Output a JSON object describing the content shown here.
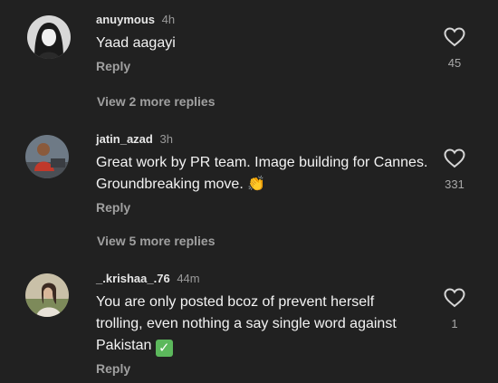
{
  "comments": [
    {
      "username": "anuymous",
      "time": "4h",
      "text": "Yaad aagayi",
      "reply_label": "Reply",
      "likes": "45",
      "avatar_icon": "profile-photo-woman-dark-hair"
    },
    {
      "username": "jatin_azad",
      "time": "3h",
      "text": "Great work by PR team. Image building for Cannes. Groundbreaking move.",
      "emoji": "👏",
      "reply_label": "Reply",
      "likes": "331",
      "avatar_icon": "profile-photo-man-red-shirt"
    },
    {
      "username": "_.krishaa_.76",
      "time": "44m",
      "text": "You are only posted bcoz of prevent herself trolling, even nothing a say single word against Pakistan",
      "emoji": "✓",
      "reply_label": "Reply",
      "likes": "1",
      "avatar_icon": "profile-photo-woman-outdoor"
    }
  ],
  "view_more": [
    "View 2 more replies",
    "View 5 more replies"
  ],
  "colors": {
    "background": "#212121",
    "primary_text": "#f3f3f3",
    "secondary_text": "#a0a0a0",
    "check_green": "#5cb85c"
  }
}
